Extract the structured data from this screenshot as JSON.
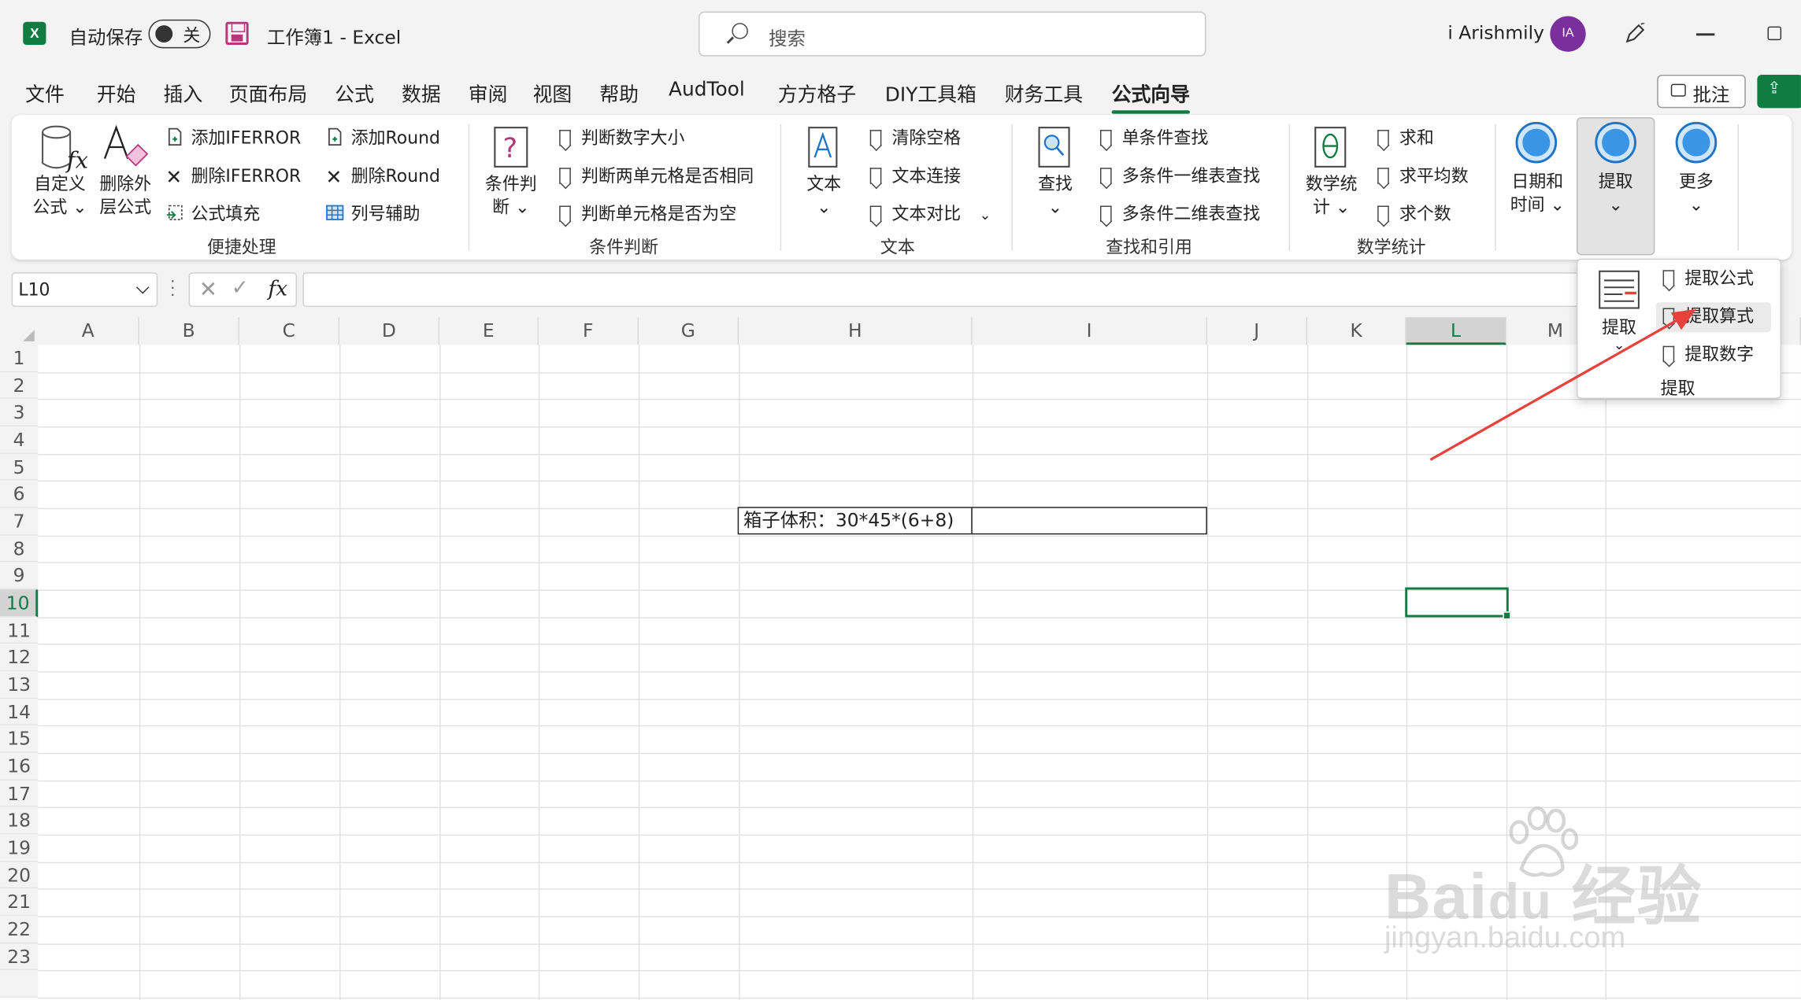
{
  "titlebar": {
    "autosave_label": "自动保存",
    "autosave_state": "关",
    "doc_title": "工作簿1 - Excel",
    "search_placeholder": "搜索",
    "user_name": "i Arishmily",
    "avatar_initials": "IA"
  },
  "menu": {
    "tabs": [
      "文件",
      "开始",
      "插入",
      "页面布局",
      "公式",
      "数据",
      "审阅",
      "视图",
      "帮助",
      "AudTool",
      "方方格子",
      "DIY工具箱",
      "财务工具",
      "公式向导"
    ],
    "active_tab": "公式向导",
    "comment_label": "批注"
  },
  "ribbon": {
    "custom_formula": [
      "自定义",
      "公式 ⌄"
    ],
    "delete_outer": [
      "删除外",
      "层公式"
    ],
    "add_iferror": "添加IFERROR",
    "del_iferror": "删除IFERROR",
    "formula_fill": "公式填充",
    "add_round": "添加Round",
    "del_round": "删除Round",
    "col_helper": "列号辅助",
    "group_quick": "便捷处理",
    "cond_big": [
      "条件判",
      "断 ⌄"
    ],
    "judge_size": "判断数字大小",
    "judge_same": "判断两单元格是否相同",
    "judge_empty": "判断单元格是否为空",
    "group_cond": "条件判断",
    "text_big": [
      "文本",
      "⌄"
    ],
    "clear_space": "清除空格",
    "text_join": "文本连接",
    "text_compare": "文本对比",
    "group_text": "文本",
    "find_big": [
      "查找",
      "⌄"
    ],
    "single_find": "单条件查找",
    "multi_1d": "多条件一维表查找",
    "multi_2d": "多条件二维表查找",
    "group_find": "查找和引用",
    "math_big": [
      "数学统",
      "计 ⌄"
    ],
    "sum": "求和",
    "avg": "求平均数",
    "count": "求个数",
    "group_math": "数学统计",
    "date_big": [
      "日期和",
      "时间 ⌄"
    ],
    "extract_big": [
      "提取",
      "⌄"
    ],
    "more_big": [
      "更多",
      "⌄"
    ]
  },
  "formula_bar": {
    "name_box": "L10",
    "fx": "fx",
    "cancel": "✕",
    "enter": "✓"
  },
  "grid": {
    "columns": [
      "A",
      "B",
      "C",
      "D",
      "E",
      "F",
      "G",
      "H",
      "I",
      "J",
      "K",
      "L",
      "M"
    ],
    "rows": [
      "1",
      "2",
      "3",
      "4",
      "5",
      "6",
      "7",
      "8",
      "9",
      "10",
      "11",
      "12",
      "13",
      "14",
      "15",
      "16",
      "17",
      "18",
      "19",
      "20",
      "21",
      "22",
      "23"
    ],
    "selected_column": "L",
    "selected_row": "10",
    "cell_h7": "箱子体积：30*45*(6+8)"
  },
  "dropdown": {
    "big_label": [
      "提取",
      "⌄"
    ],
    "items": [
      "提取公式",
      "提取算式",
      "提取数字"
    ],
    "hovered": "提取算式",
    "group_label": "提取"
  },
  "annotation": {
    "arrow_color": "#e8403a"
  },
  "colors": {
    "excel_green": "#107c41",
    "accent_blue": "#1e74c7",
    "avatar": "#7b2f9c"
  }
}
